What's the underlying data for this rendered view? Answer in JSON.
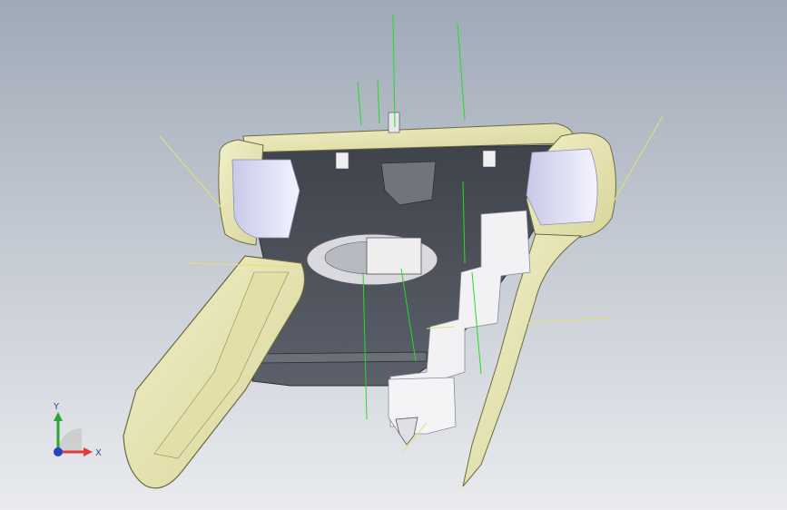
{
  "viewport": {
    "background_top": "#9fa9b7",
    "background_bottom": "#e9ebee"
  },
  "triad": {
    "x_label": "X",
    "y_label": "Y",
    "x_color": "#e23b3b",
    "y_color": "#2ca52c",
    "z_color": "#2b3fc9"
  },
  "model": {
    "shell_color": "#e9e7b6",
    "housing_color": "#4a4e57",
    "inner_face_color": "#dcdcf2",
    "ref_axis_green": "#22dd22",
    "ref_axis_yellow": "#e6e36a"
  }
}
